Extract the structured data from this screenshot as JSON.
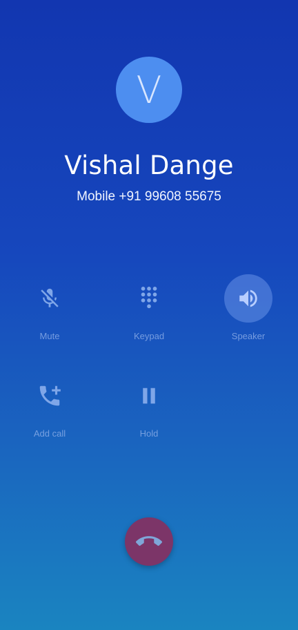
{
  "caller": {
    "initial": "V",
    "name": "Vishal Dange",
    "number_line": "Mobile +91 99608 55675"
  },
  "controls": [
    {
      "label": "Mute",
      "icon": "mic-off-icon",
      "active": false
    },
    {
      "label": "Keypad",
      "icon": "dialpad-icon",
      "active": false
    },
    {
      "label": "Speaker",
      "icon": "speaker-icon",
      "active": true
    },
    {
      "label": "Add call",
      "icon": "add-call-icon",
      "active": false
    },
    {
      "label": "Hold",
      "icon": "pause-icon",
      "active": false
    }
  ],
  "end_call": {
    "icon": "end-call-icon"
  },
  "colors": {
    "background_top": "#1236b0",
    "background_bottom": "#1a84c0",
    "avatar": "#4d8ef0",
    "end_call": "#7c3568",
    "control_icon": "#7fa6e8"
  }
}
